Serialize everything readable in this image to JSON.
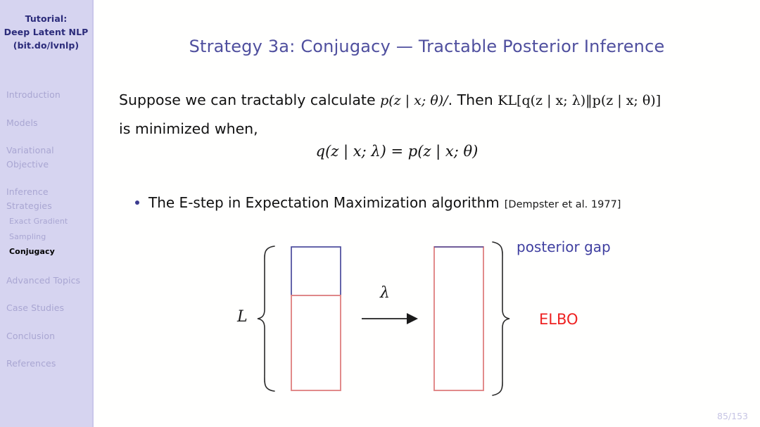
{
  "sidebar": {
    "title_lines": [
      "Tutorial:",
      "Deep Latent NLP",
      "(bit.do/lvnlp)"
    ],
    "items": [
      {
        "label": "Introduction",
        "level": "section",
        "active": false
      },
      {
        "label": "Models",
        "level": "section",
        "active": false
      },
      {
        "label": "Variational",
        "level": "section",
        "active": false
      },
      {
        "label": "Objective",
        "level": "section",
        "active": false
      },
      {
        "label": "Inference",
        "level": "section",
        "active": false
      },
      {
        "label": "Strategies",
        "level": "section",
        "active": false
      },
      {
        "label": "Exact Gradient",
        "level": "subsection",
        "active": false
      },
      {
        "label": "Sampling",
        "level": "subsection",
        "active": false
      },
      {
        "label": "Conjugacy",
        "level": "subsection",
        "active": true
      },
      {
        "label": "Advanced Topics",
        "level": "section",
        "active": false
      },
      {
        "label": "Case Studies",
        "level": "section",
        "active": false
      },
      {
        "label": "Conclusion",
        "level": "section",
        "active": false
      },
      {
        "label": "References",
        "level": "section",
        "active": false
      }
    ]
  },
  "slide": {
    "title": "Strategy 3a: Conjugacy — Tractable Posterior Inference",
    "paragraph": {
      "part1": "Suppose we can tractably calculate ",
      "math1": "p(z | x; θ)/",
      "part2": ". Then ",
      "math2": "KL[q(z | x; λ)‖p(z | x; θ)]",
      "part3": "is minimized when,"
    },
    "display_equation": "q(z | x; λ) = p(z | x; θ)",
    "bullet": {
      "text": "The E-step in Expectation Maximization algorithm",
      "citation": "[Dempster et al. 1977]"
    },
    "figure": {
      "label_L": "L",
      "label_lambda": "λ",
      "label_posterior_gap": "posterior gap",
      "label_elbo": "ELBO",
      "left_bar": {
        "top_segment_color": "#4a4a9c",
        "bottom_segment_color": "#e08585"
      },
      "right_bar": {
        "border_color": "#e08585",
        "top_edge_color": "#4a4a9c"
      }
    },
    "page_number": "85/153"
  },
  "colors": {
    "sidebar_bg": "#d6d4f0",
    "sidebar_title": "#2b2b7a",
    "sidebar_item": "#a9a6d2",
    "title": "#4f4f9e",
    "bullet": "#3b3b8f",
    "elbo": "#ee2222",
    "posterior_gap": "#3f3fa0",
    "page_number": "#c6c4e4"
  }
}
